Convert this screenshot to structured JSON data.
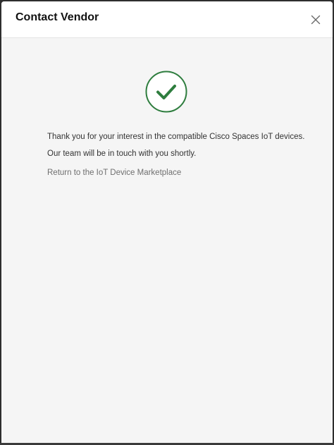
{
  "dialog": {
    "title": "Contact Vendor",
    "close_icon": "close-icon",
    "success_icon": "checkmark-circle-icon",
    "accent_color": "#2e7d3e",
    "messages": {
      "thanks": "Thank you for your interest in the compatible Cisco Spaces IoT devices.",
      "follow_up": "Our team will be in touch with you shortly."
    },
    "return_link_label": "Return to the IoT Device Marketplace"
  }
}
